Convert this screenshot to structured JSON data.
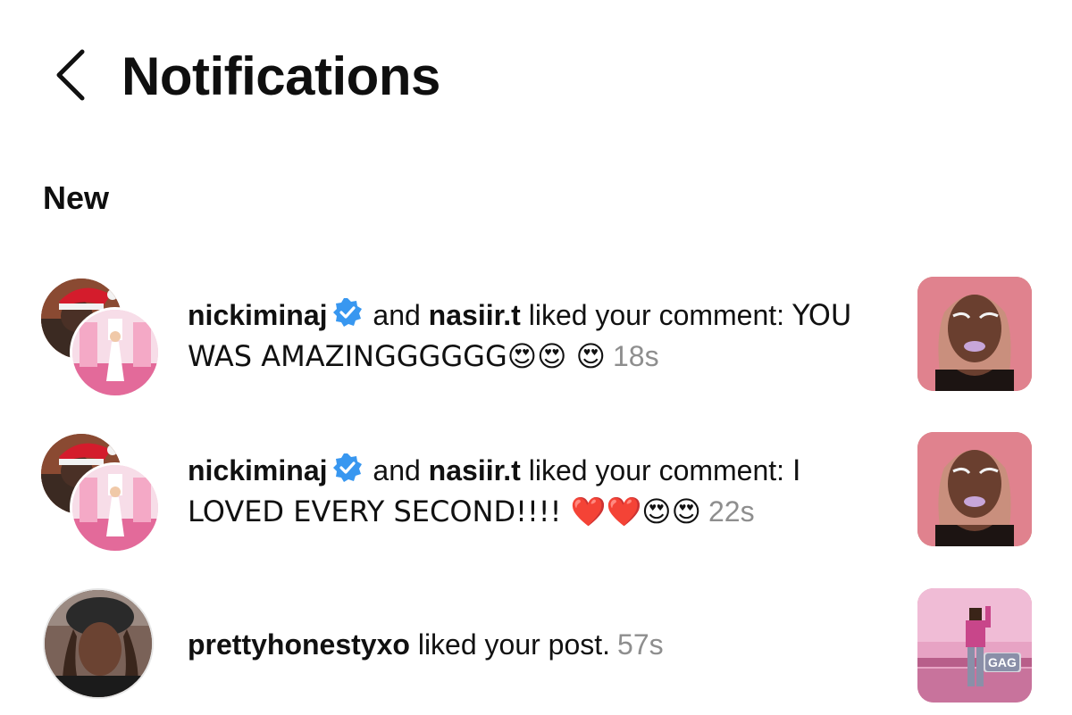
{
  "header": {
    "title": "Notifications"
  },
  "sections": {
    "new_label": "New"
  },
  "notifications": [
    {
      "user1": "nickiminaj",
      "connector": " and ",
      "user2": "nasiir.t",
      "action": " liked your comment: ",
      "comment": "YOU WAS AMAZINGGGGGG😍😍 😍",
      "time": "18s"
    },
    {
      "user1": "nickiminaj",
      "connector": " and ",
      "user2": "nasiir.t",
      "action": " liked your comment: ",
      "comment": "I LOVED EVERY SECOND!!!! ❤️❤️😍😍",
      "time": "22s"
    },
    {
      "user1": "prettyhonestyxo",
      "action": " liked your post.",
      "time": "57s"
    }
  ],
  "thumbnails": [
    {
      "label": ""
    },
    {
      "label": ""
    },
    {
      "label": "GAG"
    }
  ],
  "icons": {
    "back": "chevron-left-icon",
    "verified": "verified-badge-icon"
  },
  "colors": {
    "verified_blue": "#3897f0",
    "timestamp_gray": "#8e8e8e",
    "text": "#111111"
  }
}
